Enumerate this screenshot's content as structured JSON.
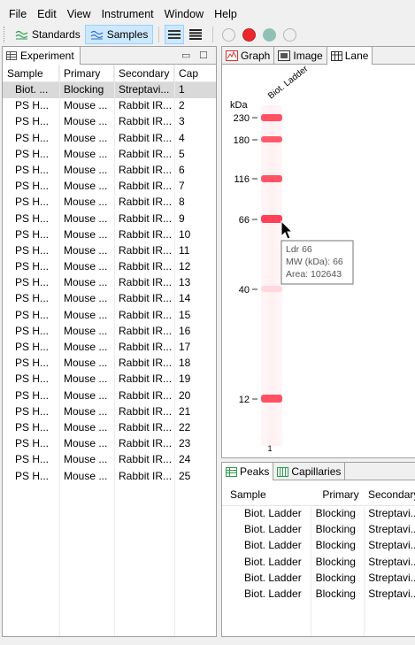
{
  "menu": [
    "File",
    "Edit",
    "View",
    "Instrument",
    "Window",
    "Help"
  ],
  "toolbar": {
    "standards_label": "Standards",
    "samples_label": "Samples",
    "icons": [
      "list-view-icon",
      "detail-view-icon",
      "empty-circle-icon",
      "red-circle-icon",
      "teal-circle-icon",
      "empty-circle-icon"
    ],
    "colors": {
      "red": "#e8282b",
      "teal": "#8fc1b4",
      "active_bg": "#cce8ff"
    }
  },
  "experiment": {
    "tab_label": "Experiment",
    "columns": [
      "Sample",
      "Primary",
      "Secondary",
      "Cap"
    ],
    "rows": [
      [
        "Biot. ...",
        "Blocking",
        "Streptavi...",
        "1"
      ],
      [
        "PS H...",
        "Mouse ...",
        "Rabbit IR...",
        "2"
      ],
      [
        "PS H...",
        "Mouse ...",
        "Rabbit IR...",
        "3"
      ],
      [
        "PS H...",
        "Mouse ...",
        "Rabbit IR...",
        "4"
      ],
      [
        "PS H...",
        "Mouse ...",
        "Rabbit IR...",
        "5"
      ],
      [
        "PS H...",
        "Mouse ...",
        "Rabbit IR...",
        "6"
      ],
      [
        "PS H...",
        "Mouse ...",
        "Rabbit IR...",
        "7"
      ],
      [
        "PS H...",
        "Mouse ...",
        "Rabbit IR...",
        "8"
      ],
      [
        "PS H...",
        "Mouse ...",
        "Rabbit IR...",
        "9"
      ],
      [
        "PS H...",
        "Mouse ...",
        "Rabbit IR...",
        "10"
      ],
      [
        "PS H...",
        "Mouse ...",
        "Rabbit IR...",
        "11"
      ],
      [
        "PS H...",
        "Mouse ...",
        "Rabbit IR...",
        "12"
      ],
      [
        "PS H...",
        "Mouse ...",
        "Rabbit IR...",
        "13"
      ],
      [
        "PS H...",
        "Mouse ...",
        "Rabbit IR...",
        "14"
      ],
      [
        "PS H...",
        "Mouse ...",
        "Rabbit IR...",
        "15"
      ],
      [
        "PS H...",
        "Mouse ...",
        "Rabbit IR...",
        "16"
      ],
      [
        "PS H...",
        "Mouse ...",
        "Rabbit IR...",
        "17"
      ],
      [
        "PS H...",
        "Mouse ...",
        "Rabbit IR...",
        "18"
      ],
      [
        "PS H...",
        "Mouse ...",
        "Rabbit IR...",
        "19"
      ],
      [
        "PS H...",
        "Mouse ...",
        "Rabbit IR...",
        "20"
      ],
      [
        "PS H...",
        "Mouse ...",
        "Rabbit IR...",
        "21"
      ],
      [
        "PS H...",
        "Mouse ...",
        "Rabbit IR...",
        "22"
      ],
      [
        "PS H...",
        "Mouse ...",
        "Rabbit IR...",
        "23"
      ],
      [
        "PS H...",
        "Mouse ...",
        "Rabbit IR...",
        "24"
      ],
      [
        "PS H...",
        "Mouse ...",
        "Rabbit IR...",
        "25"
      ]
    ],
    "selected_row": 0
  },
  "view_tabs": [
    "Graph",
    "Image",
    "Lane"
  ],
  "lane": {
    "unit_label": "kDa",
    "lane_name": "Biot. Ladder",
    "lane_number": "1",
    "markers": [
      "230",
      "180",
      "116",
      "66",
      "40",
      "12"
    ],
    "band_color": "#ff4d5e",
    "tooltip": [
      "Ldr 66",
      "MW (kDa): 66",
      "Area: 102643"
    ]
  },
  "bottom_tabs": [
    "Peaks",
    "Capillaries"
  ],
  "peaks": {
    "columns": [
      "Sample",
      "Primary",
      "Secondary"
    ],
    "rows": [
      [
        "Biot. Ladder",
        "Blocking",
        "Streptavi..."
      ],
      [
        "Biot. Ladder",
        "Blocking",
        "Streptavi..."
      ],
      [
        "Biot. Ladder",
        "Blocking",
        "Streptavi..."
      ],
      [
        "Biot. Ladder",
        "Blocking",
        "Streptavi..."
      ],
      [
        "Biot. Ladder",
        "Blocking",
        "Streptavi..."
      ],
      [
        "Biot. Ladder",
        "Blocking",
        "Streptavi..."
      ]
    ]
  }
}
